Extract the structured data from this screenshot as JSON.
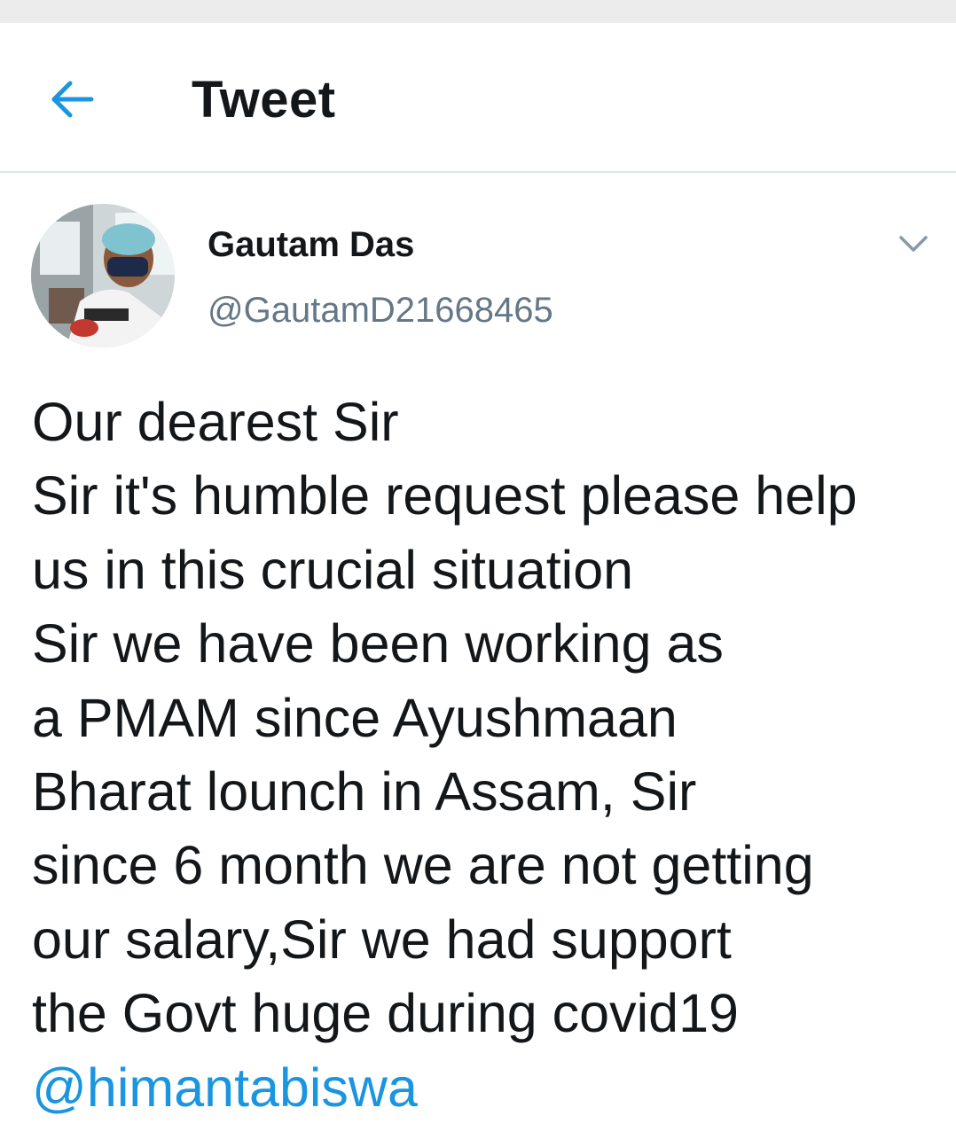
{
  "header": {
    "back_icon": "arrow-left-icon",
    "title": "Tweet"
  },
  "tweet": {
    "author": {
      "name": "Gautam Das",
      "handle": "@GautamD21668465"
    },
    "menu_icon": "chevron-down-icon",
    "lines": [
      "Our dearest Sir",
      "Sir it's humble request please help",
      "us in this crucial situation",
      "Sir we have been working as",
      "a PMAM since Ayushmaan",
      "Bharat lounch in Assam, Sir",
      "since 6 month we are not getting",
      "our salary,Sir we had support",
      "the Govt huge during covid19"
    ],
    "mention": "@himantabiswa"
  },
  "colors": {
    "accent": "#1b95e0",
    "text": "#14171a",
    "secondary_text": "#657786",
    "divider": "#e1e6ea"
  }
}
